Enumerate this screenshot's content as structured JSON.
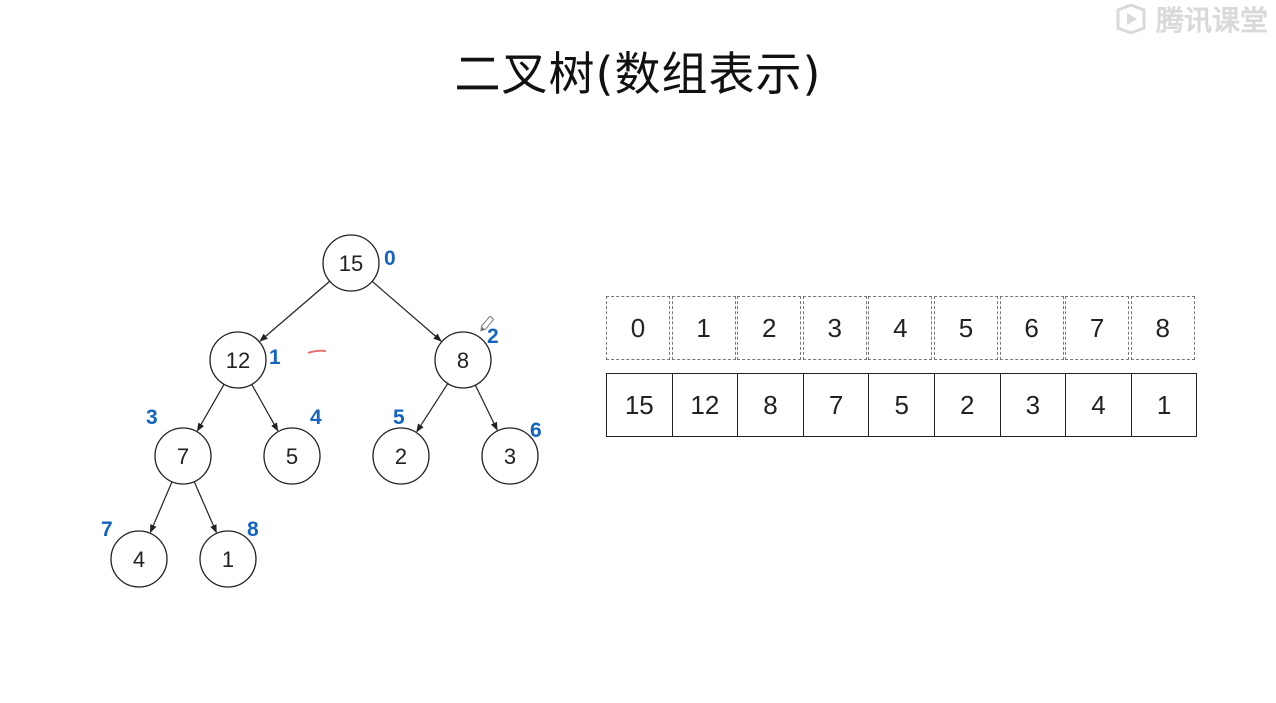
{
  "title": "二叉树(数组表示)",
  "watermark": {
    "text": "腾讯课堂",
    "icon": "play-logo-icon"
  },
  "colors": {
    "index_label": "#1565c0",
    "node_stroke": "#222222",
    "annotation": "#e57373"
  },
  "tree": {
    "nodes": [
      {
        "index": "0",
        "value": "15"
      },
      {
        "index": "1",
        "value": "12"
      },
      {
        "index": "2",
        "value": "8"
      },
      {
        "index": "3",
        "value": "7"
      },
      {
        "index": "4",
        "value": "5"
      },
      {
        "index": "5",
        "value": "2"
      },
      {
        "index": "6",
        "value": "3"
      },
      {
        "index": "7",
        "value": "4"
      },
      {
        "index": "8",
        "value": "1"
      }
    ]
  },
  "array": {
    "indices": [
      "0",
      "1",
      "2",
      "3",
      "4",
      "5",
      "6",
      "7",
      "8"
    ],
    "values": [
      "15",
      "12",
      "8",
      "7",
      "5",
      "2",
      "3",
      "4",
      "1"
    ]
  }
}
